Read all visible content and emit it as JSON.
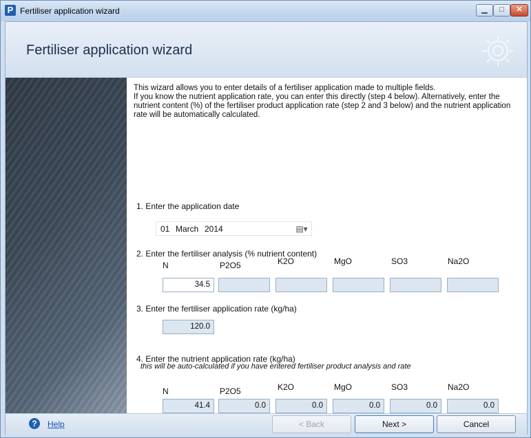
{
  "window": {
    "title": "Fertiliser application wizard",
    "app_icon": "P"
  },
  "header": {
    "title": "Fertiliser application wizard"
  },
  "intro": [
    "This wizard allows you to enter details of a fertiliser application made to multiple fields.",
    "If you know the nutrient application rate, you can enter this directly (step 4 below).  Alternatively, enter the",
    "nutrient content (%) of the fertiliser product application rate (step 2 and 3 below) and the nutrient application",
    "rate will be automatically calculated."
  ],
  "step1": {
    "label": "1. Enter the application date",
    "date": {
      "day": "01",
      "month": "March",
      "year": "2014"
    }
  },
  "step2": {
    "label": "2. Enter the fertiliser analysis (% nutrient content)",
    "columns": [
      "N",
      "P2O5",
      "K2O",
      "MgO",
      "SO3",
      "Na2O"
    ],
    "values": [
      "34.5",
      "",
      "",
      "",
      "",
      ""
    ]
  },
  "step3": {
    "label": "3. Enter the fertiliser application rate  (kg/ha)",
    "value": "120.0"
  },
  "step4": {
    "label": "4. Enter the nutrient application rate  (kg/ha)",
    "note": "this will be auto-calculated if you have entered fertiliser product analysis and rate",
    "columns": [
      "N",
      "P2O5",
      "K2O",
      "MgO",
      "SO3",
      "Na2O"
    ],
    "values": [
      "41.4",
      "0.0",
      "0.0",
      "0.0",
      "0.0",
      "0.0"
    ]
  },
  "footer": {
    "help_label": "Help",
    "back_label": "< Back",
    "next_label": "Next >",
    "cancel_label": "Cancel"
  },
  "icons": [
    "app-icon",
    "minimize-icon",
    "maximize-icon",
    "close-icon",
    "gear-icon",
    "calendar-icon",
    "help-icon"
  ]
}
